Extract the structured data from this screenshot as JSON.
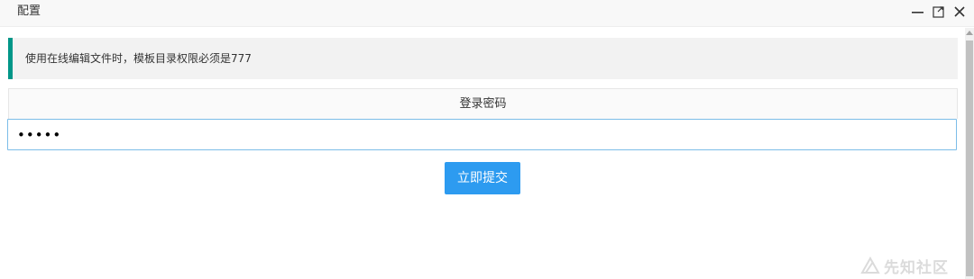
{
  "window": {
    "title": "配置",
    "controls": {
      "minimize_icon": "minimize-icon",
      "maximize_icon": "maximize-icon",
      "close_icon": "close-icon"
    }
  },
  "notice": {
    "text": "使用在线编辑文件时，模板目录权限必须是777",
    "accent_color": "#009688"
  },
  "form": {
    "password_label": "登录密码",
    "password_value": "•••••",
    "submit_label": "立即提交",
    "submit_color": "#2d9bf0"
  },
  "watermark": {
    "text": "先知社区"
  }
}
